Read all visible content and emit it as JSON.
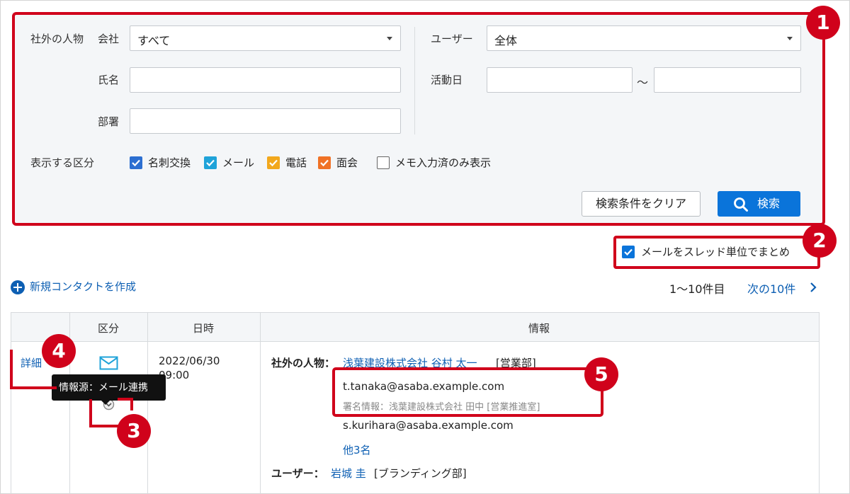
{
  "search": {
    "external_person_label": "社外の人物",
    "company_label": "会社",
    "company_value": "すべて",
    "name_label": "氏名",
    "dept_label": "部署",
    "user_label": "ユーザー",
    "user_value": "全体",
    "activity_date_label": "活動日",
    "range_sep": "〜",
    "category_label": "表示する区分",
    "categories": [
      {
        "label": "名刺交換",
        "checked": true,
        "color": "#2c6fd1"
      },
      {
        "label": "メール",
        "checked": true,
        "color": "#1fa3d9"
      },
      {
        "label": "電話",
        "checked": true,
        "color": "#f2a81d"
      },
      {
        "label": "面会",
        "checked": true,
        "color": "#f07226"
      },
      {
        "label": "メモ入力済のみ表示",
        "checked": false,
        "color": "#ffffff"
      }
    ],
    "clear_button": "検索条件をクリア",
    "search_button": "検索"
  },
  "thread_option": {
    "label": "メールをスレッド単位でまとめ",
    "checked": true
  },
  "create_contact": "新規コンタクトを作成",
  "paging": {
    "range": "1〜10件目",
    "next": "次の10件"
  },
  "table": {
    "headers": [
      "区分",
      "日時",
      "情報"
    ],
    "row": {
      "detail_link": "詳細",
      "date": "2022/06/30",
      "time": "09:00",
      "source_tooltip": "情報源：メール連携",
      "external_person_label": "社外の人物：",
      "external_person_link": "浅葉建設株式会社 谷村 太一",
      "external_person_dept": "[営業部]",
      "email1": "t.tanaka@asaba.example.com",
      "signature": "署名情報：浅葉建設株式会社 田中 [営業推進室]",
      "email2": "s.kurihara@asaba.example.com",
      "others": "他3名",
      "user_label": "ユーザー：",
      "user_link": "岩城 圭",
      "user_dept": "[ブランディング部]"
    }
  },
  "callouts": [
    "1",
    "2",
    "3",
    "4",
    "5"
  ],
  "colors": {
    "accent": "#d0021b",
    "link": "#0d5fb3",
    "primary_button": "#0a74da"
  }
}
